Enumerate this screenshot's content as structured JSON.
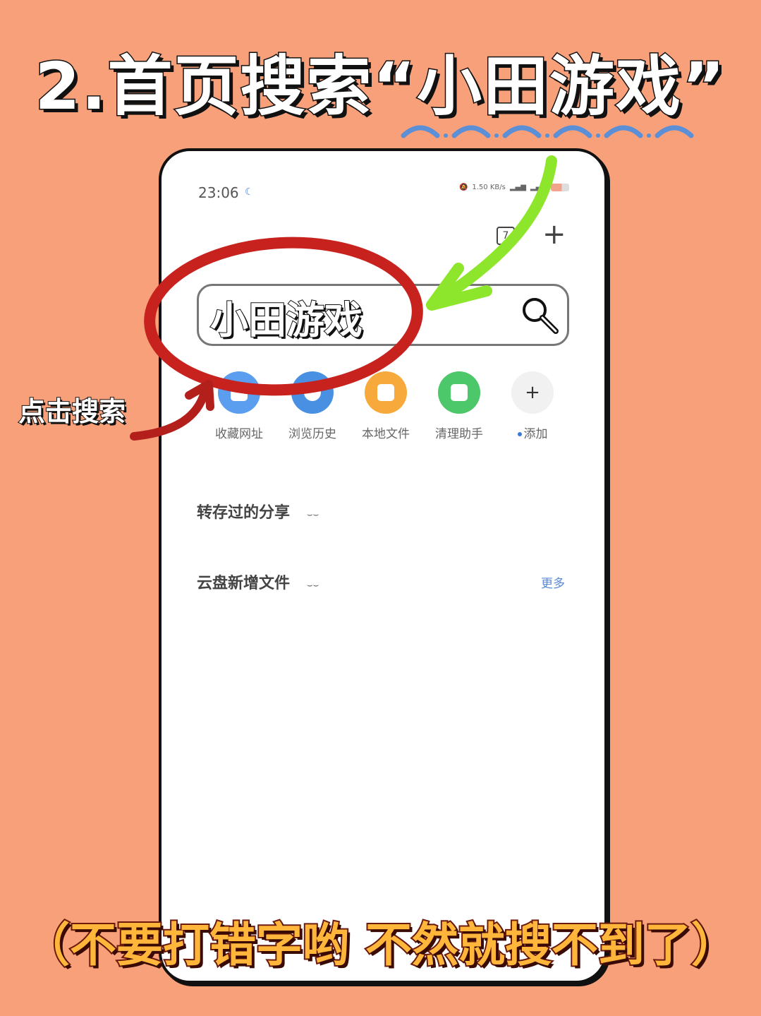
{
  "headline": "2.首页搜索“小田游戏”",
  "status_bar": {
    "time": "23:06",
    "network_speed": "1.50 KB/s"
  },
  "toolbar": {
    "tab_count": "7",
    "new_tab_symbol": "+"
  },
  "search": {
    "query": "小田游戏",
    "icon": "magnifier-icon"
  },
  "shortcuts": [
    {
      "label": "收藏网址",
      "color": "#5b9ef0"
    },
    {
      "label": "浏览历史",
      "color": "#4a90e2"
    },
    {
      "label": "本地文件",
      "color": "#f7a93b"
    },
    {
      "label": "清理助手",
      "color": "#4cc76a"
    },
    {
      "label": "添加",
      "symbol": "+",
      "color": "#f1f1f1"
    }
  ],
  "sections": {
    "saved_shares": "转存过的分享",
    "cloud_new_files": "云盘新增文件",
    "more_link": "更多"
  },
  "annotations": {
    "tap_search": "点击搜索",
    "warning": "（不要打错字哟 不然就搜不到了）"
  },
  "colors": {
    "background": "#f7a07a",
    "red_circle": "#c8221f",
    "green_arrow": "#8ee62c",
    "warning_text": "#ffb63a"
  }
}
